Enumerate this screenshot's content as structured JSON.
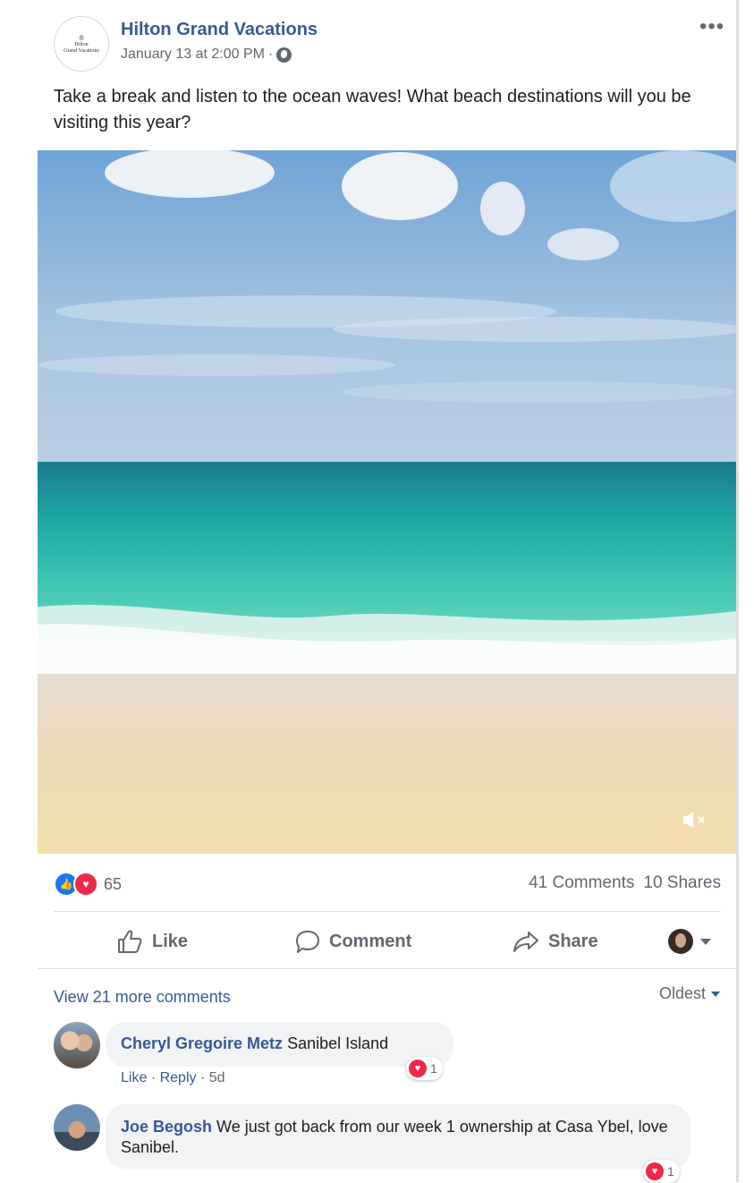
{
  "post": {
    "page_name": "Hilton Grand Vacations",
    "avatar_glyph": "®",
    "avatar_brand_line1": "Hilton",
    "avatar_brand_line2": "Grand Vacations",
    "timestamp": "January 13 at 2:00 PM",
    "separator": "·",
    "audience_icon": "globe-icon",
    "more_icon": "•••",
    "text": "Take a break and listen to the ocean waves! What beach destinations will you be visiting this year?"
  },
  "video": {
    "mute_icon": "speaker-muted-icon"
  },
  "stats": {
    "reaction_count": "65",
    "comments": "41 Comments",
    "shares": "10 Shares"
  },
  "actions": {
    "like": "Like",
    "comment": "Comment",
    "share": "Share"
  },
  "comments_section": {
    "view_more": "View 21 more comments",
    "sort": "Oldest",
    "items": [
      {
        "author": "Cheryl Gregoire Metz",
        "text": "Sanibel Island",
        "like": "Like",
        "reply": "Reply",
        "time": "5d",
        "reactions": "1"
      },
      {
        "author": "Joe Begosh",
        "text": "We just got back from our week 1 ownership at Casa Ybel, love Sanibel.",
        "reactions": "1"
      }
    ]
  },
  "colors": {
    "link_blue": "#385898",
    "like_blue": "#1877f2",
    "love_red": "#f0284a",
    "meta_gray": "#606770"
  }
}
